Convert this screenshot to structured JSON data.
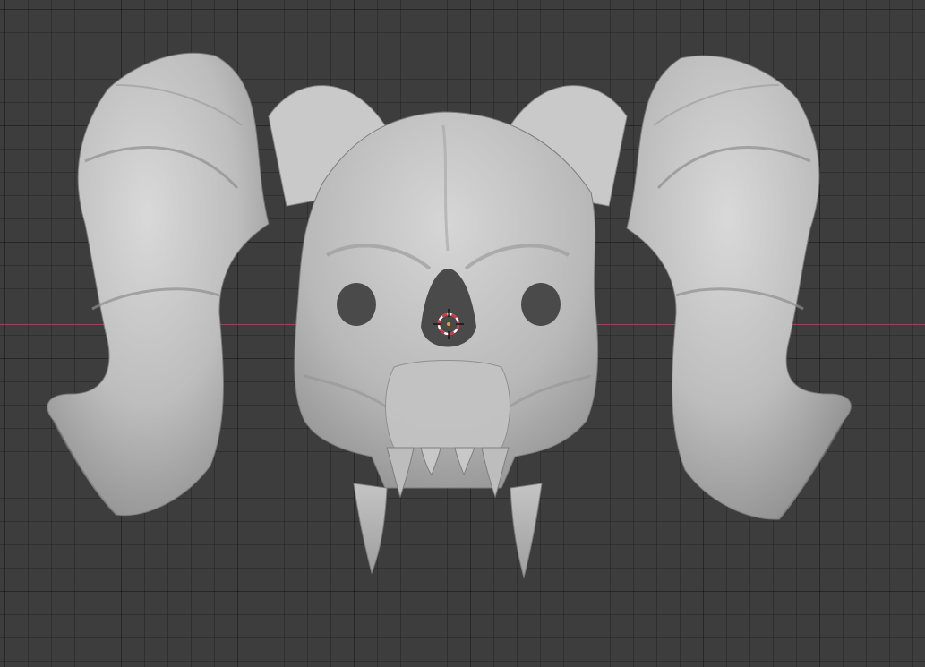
{
  "app": {
    "editor": "3D Viewport",
    "object": "ram-skull-sculpt",
    "shading": "solid"
  },
  "colors": {
    "background": "#3d3d3d",
    "grid": "#333333",
    "x_axis": "#a34a57",
    "model_light": "#cfcfcf",
    "model_mid": "#a8a8a8",
    "model_dark": "#6e6e6e",
    "cursor_red": "#e0303a",
    "cursor_white": "#ffffff"
  },
  "icons": {
    "cursor": "3d-cursor-icon"
  }
}
